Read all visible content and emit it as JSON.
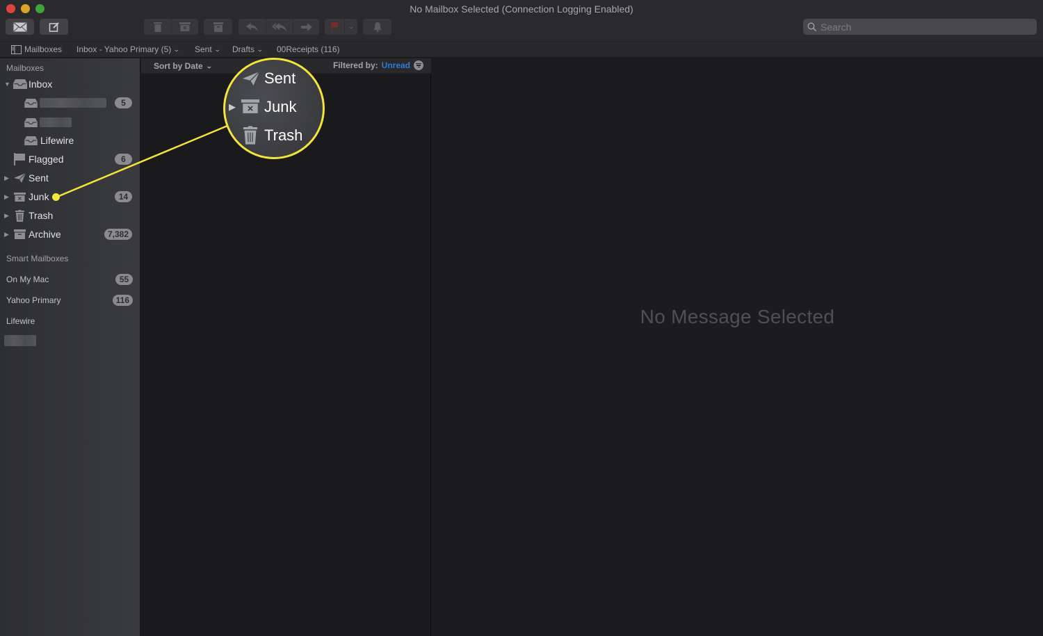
{
  "window": {
    "title": "No Mailbox Selected (Connection Logging Enabled)"
  },
  "toolbar": {
    "get_mail_icon": "envelope-icon",
    "compose_icon": "compose-icon",
    "delete_icon": "trash-icon",
    "junk_icon": "junk-icon",
    "archive_icon": "archive-icon",
    "reply_icon": "reply-icon",
    "reply_all_icon": "reply-all-icon",
    "forward_icon": "forward-icon",
    "flag_icon": "flag-icon",
    "flag_color": "#c0332b",
    "notify_icon": "bell-icon",
    "search_placeholder": "Search"
  },
  "favorites": {
    "mailboxes_label": "Mailboxes",
    "items": [
      {
        "label": "Inbox - Yahoo Primary (5)",
        "has_menu": true
      },
      {
        "label": "Sent",
        "has_menu": true
      },
      {
        "label": "Drafts",
        "has_menu": true
      },
      {
        "label": "00Receipts (116)",
        "has_menu": false
      }
    ]
  },
  "sidebar": {
    "mailboxes_heading": "Mailboxes",
    "inbox": {
      "label": "Inbox",
      "expanded": true
    },
    "inbox_children": [
      {
        "label": "",
        "redacted": true,
        "badge": "5"
      },
      {
        "label": "",
        "redacted": true,
        "badge": ""
      },
      {
        "label": "Lifewire",
        "redacted": false,
        "badge": ""
      }
    ],
    "items": [
      {
        "label": "Flagged",
        "icon": "flag-icon",
        "badge": "6"
      },
      {
        "label": "Sent",
        "icon": "paper-plane-icon",
        "badge": ""
      },
      {
        "label": "Junk",
        "icon": "junk-icon",
        "badge": "14"
      },
      {
        "label": "Trash",
        "icon": "trash-icon",
        "badge": ""
      },
      {
        "label": "Archive",
        "icon": "archive-icon",
        "badge": "7,382"
      }
    ],
    "smart_mailboxes_heading": "Smart Mailboxes",
    "accounts": [
      {
        "label": "On My Mac",
        "badge": "55"
      },
      {
        "label": "Yahoo Primary",
        "badge": "116"
      },
      {
        "label": "Lifewire",
        "badge": ""
      }
    ]
  },
  "message_list": {
    "sort_label": "Sort by Date",
    "filter_prefix": "Filtered by:",
    "filter_value": "Unread",
    "filter_color": "#2e7bd6"
  },
  "reader": {
    "empty_text": "No Message Selected"
  },
  "callout": {
    "color": "#f4e53b",
    "rows": [
      {
        "label": "Sent",
        "icon": "paper-plane-icon"
      },
      {
        "label": "Junk",
        "icon": "junk-icon"
      },
      {
        "label": "Trash",
        "icon": "trash-icon"
      }
    ],
    "target": "Junk"
  }
}
